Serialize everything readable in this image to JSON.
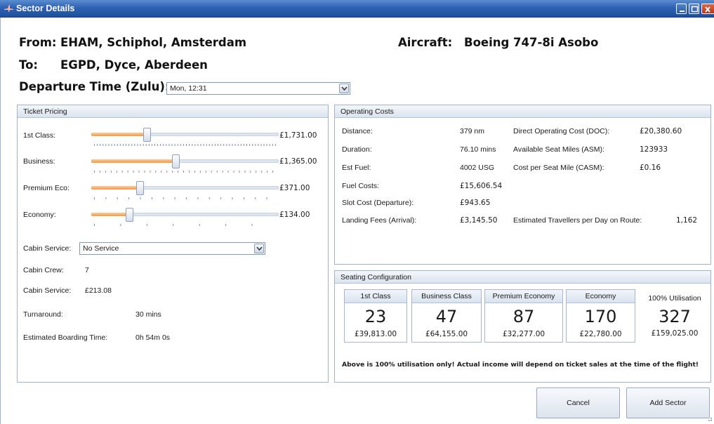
{
  "window": {
    "title": "Sector Details",
    "controls": [
      "minimize-icon",
      "maximize-icon",
      "close-icon"
    ]
  },
  "header": {
    "from_label": "From:",
    "from_value": "EHAM, Schiphol, Amsterdam",
    "to_label": "To:",
    "to_value": "EGPD, Dyce, Aberdeen",
    "aircraft_label": "Aircraft:",
    "aircraft_value": "Boeing 747-8i Asobo",
    "departure_label": "Departure Time (Zulu):",
    "departure_value": "Mon, 12:31"
  },
  "ticket_pricing": {
    "title": "Ticket Pricing",
    "classes": [
      {
        "label": "1st Class:",
        "price": "£1,731.00",
        "level": 0.29
      },
      {
        "label": "Business:",
        "price": "£1,365.00",
        "level": 0.45
      },
      {
        "label": "Premium Eco:",
        "price": "£371.00",
        "level": 0.25
      },
      {
        "label": "Economy:",
        "price": "£134.00",
        "level": 0.19
      }
    ],
    "cabin_service_label": "Cabin Service:",
    "cabin_service_value": "No Service",
    "cabin_crew_label": "Cabin Crew:",
    "cabin_crew_value": "7",
    "cabin_service_cost_label": "Cabin Service:",
    "cabin_service_cost_value": "£213.08",
    "turnaround_label": "Turnaround:",
    "turnaround_value": "30 mins",
    "boarding_label": "Estimated Boarding Time:",
    "boarding_value": "0h 54m 0s"
  },
  "operating_costs": {
    "title": "Operating Costs",
    "rows": [
      {
        "label": "Distance:",
        "value": "379 nm"
      },
      {
        "label": "Duration:",
        "value": "76.10 mins"
      },
      {
        "label": "Est Fuel:",
        "value": "4002 USG"
      },
      {
        "label": "Fuel Costs:",
        "value": "£15,606.54"
      },
      {
        "label": "Slot Cost (Departure):",
        "value": "£943.65"
      },
      {
        "label": "Landing Fees (Arrival):",
        "value": "£3,145.50"
      }
    ],
    "right_rows": [
      {
        "label": "Direct Operating Cost (DOC):",
        "value": "£20,380.60"
      },
      {
        "label": "Available Seat Miles (ASM):",
        "value": "123933"
      },
      {
        "label": "Cost per Seat Mile (CASM):",
        "value": "£0.16"
      }
    ],
    "travellers_label": "Estimated Travellers per Day on Route:",
    "travellers_value": "1,162"
  },
  "seating": {
    "title": "Seating Configuration",
    "boxes": [
      {
        "label": "1st Class",
        "count": "23",
        "price": "£39,813.00"
      },
      {
        "label": "Business Class",
        "count": "47",
        "price": "£64,155.00"
      },
      {
        "label": "Premium Economy",
        "count": "87",
        "price": "£32,277.00"
      },
      {
        "label": "Economy",
        "count": "170",
        "price": "£22,780.00"
      }
    ],
    "total": {
      "label": "100% Utilisation",
      "count": "327",
      "price": "£159,025.00"
    },
    "note": "Above is 100% utilisation only!  Actual income will depend on ticket sales at the time of the flight!"
  },
  "buttons": {
    "cancel": "Cancel",
    "add": "Add Sector"
  },
  "colors": {
    "titlebar": "#2f62b4",
    "slider_fill": "#f39a48",
    "panel_border": "#9fb3cf"
  }
}
